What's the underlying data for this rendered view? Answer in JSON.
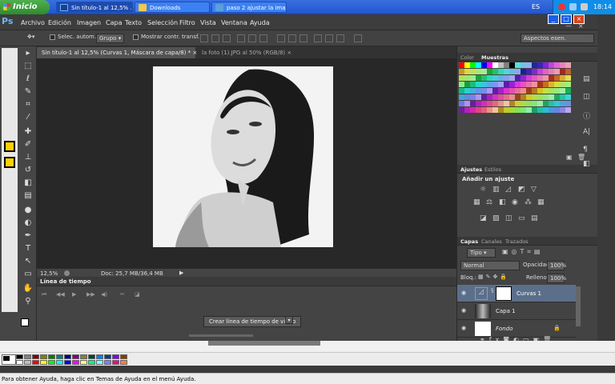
{
  "taskbar": {
    "start_label": "Inicio",
    "tasks": [
      {
        "label": "Sin título-1 al 12,5% ...",
        "icon_color": "#1e3f8a"
      },
      {
        "label": "Downloads",
        "icon_color": "#f2c94c"
      },
      {
        "label": "paso 2 ajustar la ima...",
        "icon_color": "#5aa0e0"
      }
    ],
    "lang": "ES",
    "clock": "18:14"
  },
  "menubar": {
    "logo": "Ps",
    "items": [
      "Archivo",
      "Edición",
      "Imagen",
      "Capa",
      "Texto",
      "Selección",
      "Filtro",
      "Vista",
      "Ventana",
      "Ayuda"
    ]
  },
  "options": {
    "auto_select": "Selec. autom.:",
    "group": "Grupo",
    "show_transform": "Mostrar contr. transf.",
    "workspace": "Aspectos esen."
  },
  "doc_tabs": [
    {
      "label": "Sin título-1 al 12,5% (Curvas 1, Máscara de capa/8) *",
      "close": "×"
    },
    {
      "label": "la foto (1).JPG al 50% (RGB/8)",
      "close": "×"
    }
  ],
  "status": {
    "zoom": "12,5%",
    "doc": "Doc: 25,7 MB/36,4 MB"
  },
  "timeline": {
    "title": "Línea de tiempo",
    "create_button": "Crear línea de tiempo de vídeo"
  },
  "panels": {
    "color_tabs": [
      "Color",
      "Muestras"
    ],
    "adjust_tabs": [
      "Ajustes",
      "Estilos"
    ],
    "adjust_title": "Añadir un ajuste",
    "layers_tabs": [
      "Capas",
      "Canales",
      "Trazados"
    ],
    "kind": "Tipo",
    "blend": "Normal",
    "opacity_label": "Opacidad:",
    "opacity": "100%",
    "lock_label": "Bloq.:",
    "fill_label": "Relleno:",
    "fill": "100%",
    "layers": [
      {
        "name": "Curvas 1"
      },
      {
        "name": "Capa 1"
      },
      {
        "name": "Fondo"
      }
    ]
  },
  "palette_colors": [
    "#000000",
    "#808080",
    "#800000",
    "#808000",
    "#008000",
    "#008080",
    "#000080",
    "#800080",
    "#808040",
    "#004040",
    "#0080ff",
    "#004080",
    "#8000ff",
    "#804000",
    "#ffffff",
    "#c0c0c0",
    "#ff0000",
    "#ffff00",
    "#00ff00",
    "#00ffff",
    "#0000ff",
    "#ff00ff",
    "#ffff80",
    "#00ff80",
    "#80ffff",
    "#8080ff",
    "#ff0080",
    "#ff8040"
  ],
  "xp_status": "Para obtener Ayuda, haga clic en Temas de Ayuda en el menú Ayuda."
}
